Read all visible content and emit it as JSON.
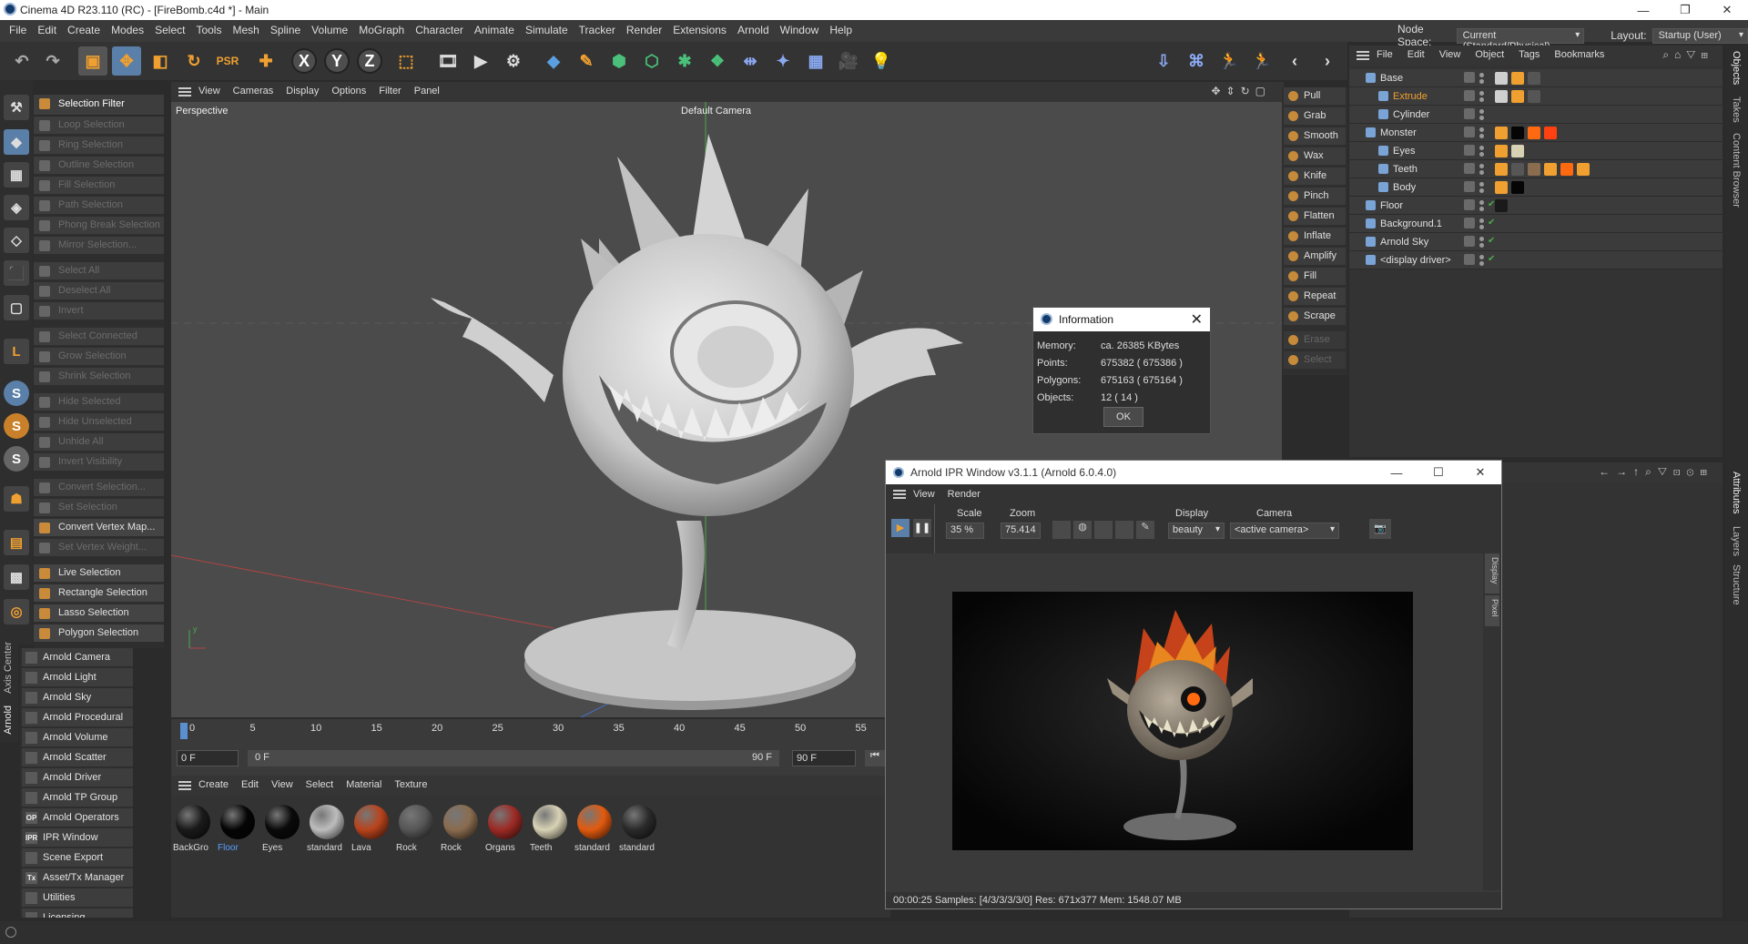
{
  "window": {
    "title": "Cinema 4D R23.110 (RC) - [FireBomb.c4d *] - Main",
    "controls": [
      "—",
      "❐",
      "✕"
    ]
  },
  "menubar": {
    "items": [
      "File",
      "Edit",
      "Create",
      "Modes",
      "Select",
      "Tools",
      "Mesh",
      "Spline",
      "Volume",
      "MoGraph",
      "Character",
      "Animate",
      "Simulate",
      "Tracker",
      "Render",
      "Extensions",
      "Arnold",
      "Window",
      "Help"
    ],
    "node_space_label": "Node Space:",
    "node_space_value": "Current (Standard/Physical)",
    "layout_label": "Layout:",
    "layout_value": "Startup (User)"
  },
  "toolbar": {
    "x_label": "X",
    "y_label": "Y",
    "z_label": "Z"
  },
  "selection_menu": {
    "header": "Selection Filter",
    "items": [
      {
        "label": "Loop Selection",
        "enabled": false
      },
      {
        "label": "Ring Selection",
        "enabled": false
      },
      {
        "label": "Outline Selection",
        "enabled": false
      },
      {
        "label": "Fill Selection",
        "enabled": false
      },
      {
        "label": "Path Selection",
        "enabled": false
      },
      {
        "label": "Phong Break Selection",
        "enabled": false
      },
      {
        "label": "Mirror Selection...",
        "enabled": false
      },
      {
        "label": "Select All",
        "enabled": false
      },
      {
        "label": "Deselect All",
        "enabled": false
      },
      {
        "label": "Invert",
        "enabled": false
      },
      {
        "label": "Select Connected",
        "enabled": false
      },
      {
        "label": "Grow Selection",
        "enabled": false
      },
      {
        "label": "Shrink Selection",
        "enabled": false
      },
      {
        "label": "Hide Selected",
        "enabled": false
      },
      {
        "label": "Hide Unselected",
        "enabled": false
      },
      {
        "label": "Unhide All",
        "enabled": false
      },
      {
        "label": "Invert Visibility",
        "enabled": false
      },
      {
        "label": "Convert Selection...",
        "enabled": false
      },
      {
        "label": "Set Selection",
        "enabled": false
      },
      {
        "label": "Convert Vertex Map...",
        "enabled": true
      },
      {
        "label": "Set Vertex Weight...",
        "enabled": false
      },
      {
        "label": "Live Selection",
        "enabled": true
      },
      {
        "label": "Rectangle Selection",
        "enabled": true
      },
      {
        "label": "Lasso Selection",
        "enabled": true
      },
      {
        "label": "Polygon Selection",
        "enabled": true
      }
    ]
  },
  "left_tabs": {
    "axis_center": "Axis Center",
    "arnold": "Arnold"
  },
  "arnold_menu": [
    {
      "icon": "camera-icon",
      "abbr": "",
      "label": "Arnold Camera"
    },
    {
      "icon": "light-icon",
      "abbr": "",
      "label": "Arnold Light"
    },
    {
      "icon": "sky-icon",
      "abbr": "",
      "label": "Arnold Sky"
    },
    {
      "icon": "procedural-icon",
      "abbr": "",
      "label": "Arnold Procedural"
    },
    {
      "icon": "volume-icon",
      "abbr": "",
      "label": "Arnold Volume"
    },
    {
      "icon": "scatter-icon",
      "abbr": "",
      "label": "Arnold Scatter"
    },
    {
      "icon": "driver-icon",
      "abbr": "",
      "label": "Arnold Driver"
    },
    {
      "icon": "tp-group-icon",
      "abbr": "",
      "label": "Arnold TP Group"
    },
    {
      "icon": "operators-icon",
      "abbr": "OP",
      "label": "Arnold Operators"
    },
    {
      "icon": "ipr-icon",
      "abbr": "IPR",
      "label": "IPR Window"
    },
    {
      "icon": "scene-export-icon",
      "abbr": "",
      "label": "Scene Export"
    },
    {
      "icon": "asset-manager-icon",
      "abbr": "Tx",
      "label": "Asset/Tx Manager"
    },
    {
      "icon": "utilities-icon",
      "abbr": "",
      "label": "Utilities"
    },
    {
      "icon": "licensing-icon",
      "abbr": "",
      "label": "Licensing"
    }
  ],
  "viewport": {
    "menu": [
      "View",
      "Cameras",
      "Display",
      "Options",
      "Filter",
      "Panel"
    ],
    "projection": "Perspective",
    "camera": "Default Camera"
  },
  "brushes": [
    {
      "label": "Pull",
      "enabled": true
    },
    {
      "label": "Grab",
      "enabled": true
    },
    {
      "label": "Smooth",
      "enabled": true
    },
    {
      "label": "Wax",
      "enabled": true
    },
    {
      "label": "Knife",
      "enabled": true
    },
    {
      "label": "Pinch",
      "enabled": true
    },
    {
      "label": "Flatten",
      "enabled": true
    },
    {
      "label": "Inflate",
      "enabled": true
    },
    {
      "label": "Amplify",
      "enabled": true
    },
    {
      "label": "Fill",
      "enabled": true
    },
    {
      "label": "Repeat",
      "enabled": true
    },
    {
      "label": "Scrape",
      "enabled": true
    },
    {
      "label": "Erase",
      "enabled": false
    },
    {
      "label": "Select",
      "enabled": false
    }
  ],
  "object_manager": {
    "menu": [
      "File",
      "Edit",
      "View",
      "Object",
      "Tags",
      "Bookmarks"
    ],
    "objects": [
      {
        "name": "Base",
        "indent": 0,
        "highlight": false
      },
      {
        "name": "Extrude",
        "indent": 1,
        "highlight": true
      },
      {
        "name": "Cylinder",
        "indent": 1,
        "highlight": false
      },
      {
        "name": "Monster",
        "indent": 0,
        "highlight": false
      },
      {
        "name": "Eyes",
        "indent": 1,
        "highlight": false
      },
      {
        "name": "Teeth",
        "indent": 1,
        "highlight": false
      },
      {
        "name": "Body",
        "indent": 1,
        "highlight": false
      },
      {
        "name": "Floor",
        "indent": 0,
        "highlight": false
      },
      {
        "name": "Background.1",
        "indent": 0,
        "highlight": false
      },
      {
        "name": "Arnold Sky",
        "indent": 0,
        "highlight": false
      },
      {
        "name": "<display driver>",
        "indent": 0,
        "highlight": false
      }
    ]
  },
  "side_tabs": {
    "top": [
      "Objects",
      "Takes",
      "Content Browser"
    ],
    "bottom": [
      "Attributes",
      "Layers",
      "Structure"
    ]
  },
  "timeline": {
    "ticks": [
      "0",
      "5",
      "10",
      "15",
      "20",
      "25",
      "30",
      "35",
      "40",
      "45",
      "50",
      "55"
    ],
    "current_frame": "0 F",
    "range_start": "0 F",
    "range_end": "90 F",
    "max_frame": "90 F"
  },
  "material_manager": {
    "menu": [
      "Create",
      "Edit",
      "View",
      "Select",
      "Material",
      "Texture"
    ],
    "materials": [
      {
        "label": "BackGro",
        "color": "#1a1a1a",
        "selected": false
      },
      {
        "label": "Floor",
        "color": "#050505",
        "selected": true
      },
      {
        "label": "Eyes",
        "color": "#0a0a0a",
        "selected": false
      },
      {
        "label": "standard",
        "color": "#bdbdbd",
        "selected": false
      },
      {
        "label": "Lava",
        "color": "#b8431c",
        "selected": false
      },
      {
        "label": "Rock",
        "color": "#565656",
        "selected": false
      },
      {
        "label": "Rock",
        "color": "#8a6c4f",
        "selected": false
      },
      {
        "label": "Organs",
        "color": "#9d2a25",
        "selected": false
      },
      {
        "label": "Teeth",
        "color": "#d8d2b5",
        "selected": false
      },
      {
        "label": "standard",
        "color": "#e25a0f",
        "selected": false
      },
      {
        "label": "standard",
        "color": "#2a2a2a",
        "selected": false
      }
    ]
  },
  "info_dialog": {
    "title": "Information",
    "rows": [
      {
        "key": "Memory:",
        "value": "ca. 26385 KBytes"
      },
      {
        "key": "Points:",
        "value": "675382 ( 675386 )"
      },
      {
        "key": "Polygons:",
        "value": "675163 ( 675164 )"
      },
      {
        "key": "Objects:",
        "value": "12 ( 14 )"
      }
    ],
    "ok": "OK"
  },
  "ipr_window": {
    "title": "Arnold IPR Window v3.1.1 (Arnold 6.0.4.0)",
    "menu": [
      "View",
      "Render"
    ],
    "scale_label": "Scale",
    "scale_value": "35 %",
    "zoom_label": "Zoom",
    "zoom_value": "75.414",
    "display_label": "Display",
    "display_value": "beauty",
    "camera_label": "Camera",
    "camera_value": "<active camera>",
    "side_tabs": [
      "Display",
      "Pixel"
    ],
    "status": "00:00:25  Samples: [4/3/3/3/3/0]  Res: 671x377  Mem: 1548.07 MB"
  }
}
